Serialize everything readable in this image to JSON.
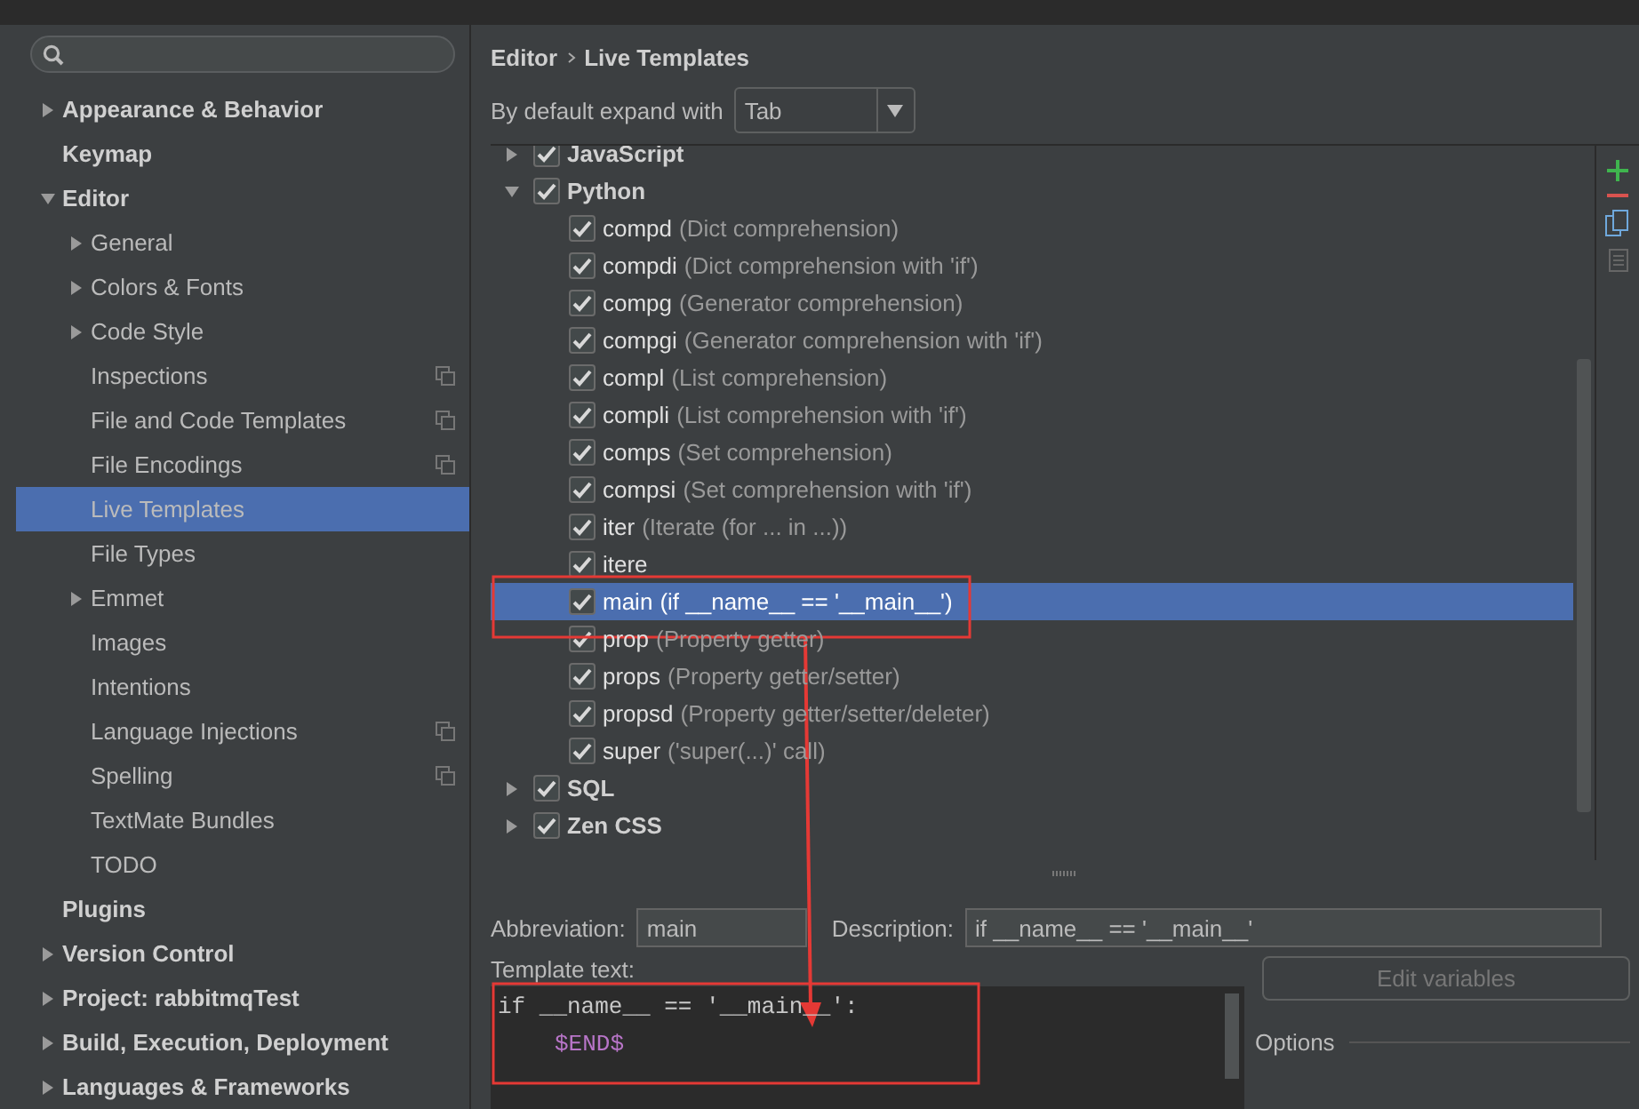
{
  "sidebar": {
    "items": [
      {
        "label": "Appearance & Behavior",
        "expanded": false,
        "expandable": true,
        "selected": false,
        "project_level": false
      },
      {
        "label": "Keymap",
        "expandable": false,
        "selected": false,
        "project_level": false
      },
      {
        "label": "Editor",
        "expanded": true,
        "expandable": true,
        "selected": false,
        "project_level": false,
        "children": [
          {
            "label": "General",
            "expandable": true,
            "expanded": false,
            "selected": false,
            "project_level": false
          },
          {
            "label": "Colors & Fonts",
            "expandable": true,
            "expanded": false,
            "selected": false,
            "project_level": false
          },
          {
            "label": "Code Style",
            "expandable": true,
            "expanded": false,
            "selected": false,
            "project_level": false
          },
          {
            "label": "Inspections",
            "expandable": false,
            "selected": false,
            "project_level": true
          },
          {
            "label": "File and Code Templates",
            "expandable": false,
            "selected": false,
            "project_level": true
          },
          {
            "label": "File Encodings",
            "expandable": false,
            "selected": false,
            "project_level": true
          },
          {
            "label": "Live Templates",
            "expandable": false,
            "selected": true,
            "project_level": false
          },
          {
            "label": "File Types",
            "expandable": false,
            "selected": false,
            "project_level": false
          },
          {
            "label": "Emmet",
            "expandable": true,
            "expanded": false,
            "selected": false,
            "project_level": false
          },
          {
            "label": "Images",
            "expandable": false,
            "selected": false,
            "project_level": false
          },
          {
            "label": "Intentions",
            "expandable": false,
            "selected": false,
            "project_level": false
          },
          {
            "label": "Language Injections",
            "expandable": false,
            "selected": false,
            "project_level": true
          },
          {
            "label": "Spelling",
            "expandable": false,
            "selected": false,
            "project_level": true
          },
          {
            "label": "TextMate Bundles",
            "expandable": false,
            "selected": false,
            "project_level": false
          },
          {
            "label": "TODO",
            "expandable": false,
            "selected": false,
            "project_level": false
          }
        ]
      },
      {
        "label": "Plugins",
        "expandable": false,
        "selected": false,
        "project_level": false
      },
      {
        "label": "Version Control",
        "expandable": true,
        "expanded": false,
        "selected": false,
        "project_level": false
      },
      {
        "label": "Project: rabbitmqTest",
        "expandable": true,
        "expanded": false,
        "selected": false,
        "project_level": false
      },
      {
        "label": "Build, Execution, Deployment",
        "expandable": true,
        "expanded": false,
        "selected": false,
        "project_level": false
      },
      {
        "label": "Languages & Frameworks",
        "expandable": true,
        "expanded": false,
        "selected": false,
        "project_level": false
      }
    ]
  },
  "breadcrumb": [
    "Editor",
    "Live Templates"
  ],
  "expand_with": {
    "label": "By default expand with",
    "value": "Tab"
  },
  "template_groups": [
    {
      "name": "JavaScript",
      "checked": true,
      "expanded": false
    },
    {
      "name": "Python",
      "checked": true,
      "expanded": true,
      "templates": [
        {
          "abbreviation": "compd",
          "description": "(Dict comprehension)",
          "checked": true,
          "selected": false
        },
        {
          "abbreviation": "compdi",
          "description": "(Dict comprehension with 'if')",
          "checked": true,
          "selected": false
        },
        {
          "abbreviation": "compg",
          "description": "(Generator comprehension)",
          "checked": true,
          "selected": false
        },
        {
          "abbreviation": "compgi",
          "description": "(Generator comprehension with 'if')",
          "checked": true,
          "selected": false
        },
        {
          "abbreviation": "compl",
          "description": "(List comprehension)",
          "checked": true,
          "selected": false
        },
        {
          "abbreviation": "compli",
          "description": "(List comprehension with 'if')",
          "checked": true,
          "selected": false
        },
        {
          "abbreviation": "comps",
          "description": "(Set comprehension)",
          "checked": true,
          "selected": false
        },
        {
          "abbreviation": "compsi",
          "description": "(Set comprehension with 'if')",
          "checked": true,
          "selected": false
        },
        {
          "abbreviation": "iter",
          "description": "(Iterate (for ... in ...))",
          "checked": true,
          "selected": false
        },
        {
          "abbreviation": "itere",
          "checked": true,
          "selected": false
        },
        {
          "abbreviation": "main",
          "description": "(if __name__ == '__main__')",
          "checked": true,
          "selected": true
        },
        {
          "abbreviation": "prop",
          "description": "(Property getter)",
          "checked": true,
          "selected": false
        },
        {
          "abbreviation": "props",
          "description": "(Property getter/setter)",
          "checked": true,
          "selected": false
        },
        {
          "abbreviation": "propsd",
          "description": "(Property getter/setter/deleter)",
          "checked": true,
          "selected": false
        },
        {
          "abbreviation": "super",
          "description": "('super(...)' call)",
          "checked": true,
          "selected": false
        }
      ]
    },
    {
      "name": "SQL",
      "checked": true,
      "expanded": false
    },
    {
      "name": "Zen CSS",
      "checked": true,
      "expanded": false
    }
  ],
  "abbreviation": {
    "label": "Abbreviation:",
    "value": "main"
  },
  "description": {
    "label": "Description:",
    "value": "if __name__ == '__main__'"
  },
  "template_text": {
    "label": "Template text:",
    "lines": [
      {
        "kind": "code",
        "text": "if __name__ == '__main__':"
      },
      {
        "kind": "variable",
        "text": "$END$"
      }
    ]
  },
  "edit_variables_button": "Edit variables",
  "options": {
    "title": "Options"
  }
}
